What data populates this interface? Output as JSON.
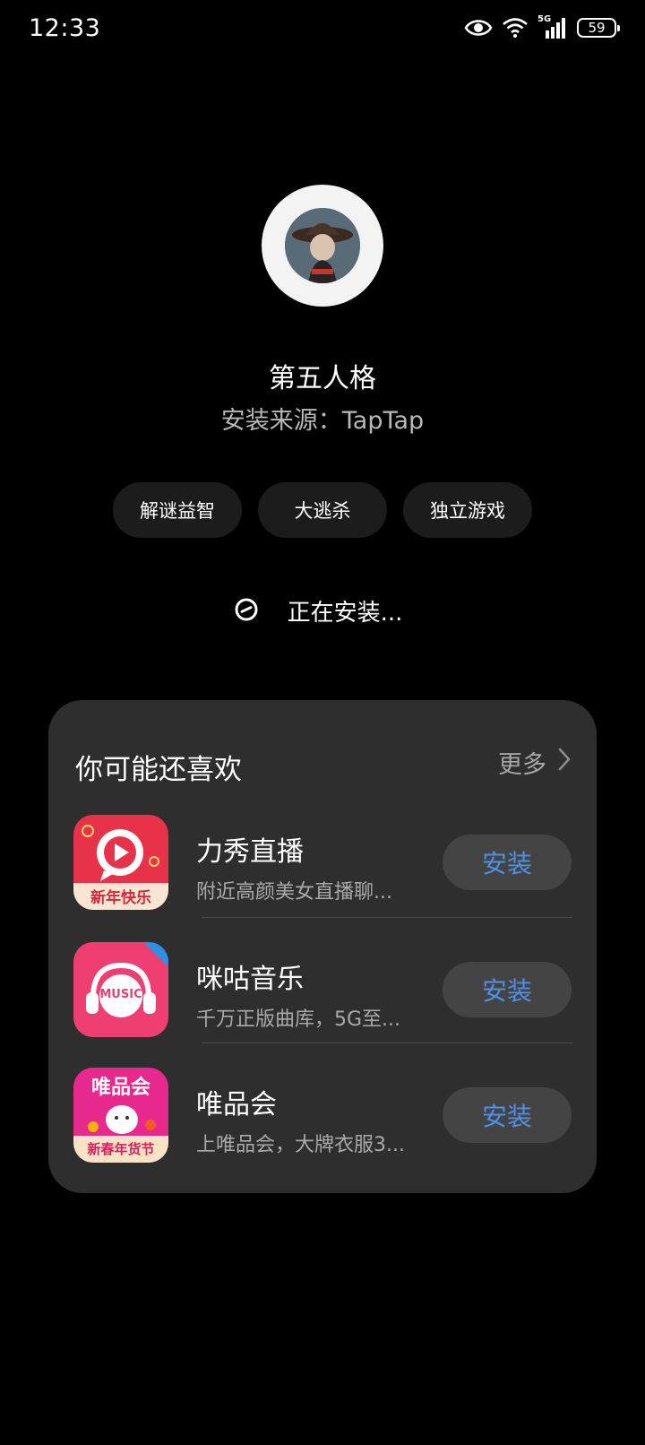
{
  "status_bar": {
    "time": "12:33",
    "network_label": "5G",
    "battery": "59"
  },
  "app": {
    "name": "第五人格",
    "install_source": "安装来源：TapTap"
  },
  "tags": [
    "解谜益智",
    "大逃杀",
    "独立游戏"
  ],
  "install_status": "正在安装...",
  "recommendations": {
    "title": "你可能还喜欢",
    "more_label": "更多",
    "items": [
      {
        "name": "力秀直播",
        "description": "附近高颜美女直播聊...",
        "button": "安装",
        "icon_caption": "新年快乐"
      },
      {
        "name": "咪咕音乐",
        "description": "千万正版曲库，5G至...",
        "button": "安装",
        "icon_caption": "MUSIC"
      },
      {
        "name": "唯品会",
        "description": "上唯品会，大牌衣服3...",
        "button": "安装",
        "icon_caption": "唯品会",
        "icon_caption_sub": "新春年货节"
      }
    ]
  },
  "colors": {
    "background": "#000000",
    "card": "#2e2e2e",
    "tag_bg": "#1c1c1c",
    "button_bg": "#444444",
    "accent_blue": "#4f8fe8"
  }
}
